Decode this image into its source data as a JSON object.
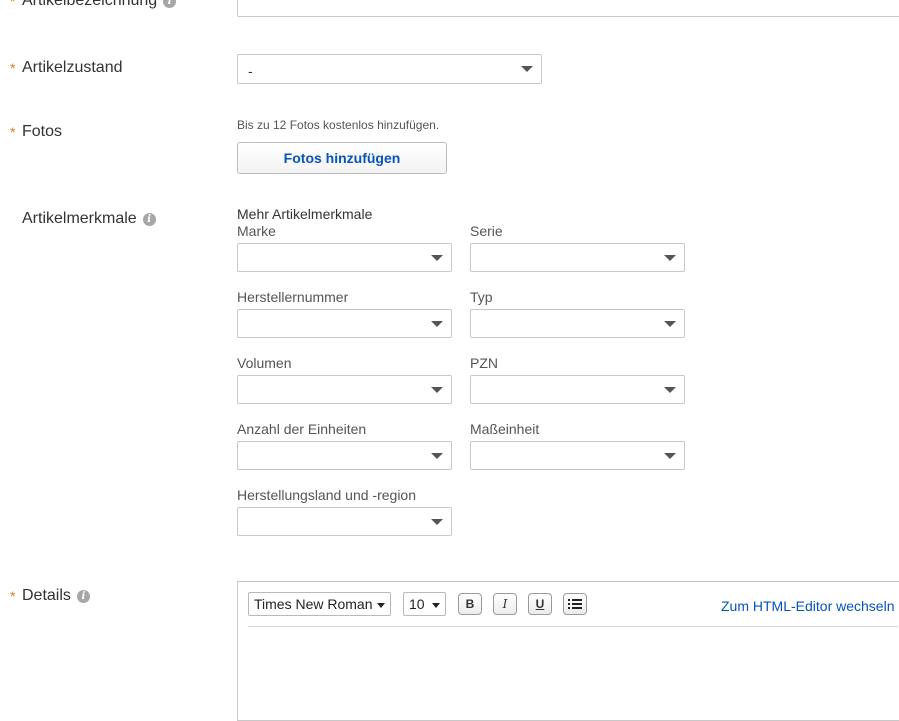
{
  "rows": {
    "title": {
      "label": "Artikelbezeichnung"
    },
    "condition": {
      "label": "Artikelzustand",
      "value": "-"
    },
    "photos": {
      "label": "Fotos",
      "hint": "Bis zu 12 Fotos kostenlos hinzufügen.",
      "button": "Fotos hinzufügen"
    },
    "specifics": {
      "label": "Artikelmerkmale",
      "heading": "Mehr Artikelmerkmale",
      "fields": {
        "marke": "Marke",
        "serie": "Serie",
        "herstellernummer": "Herstellernummer",
        "typ": "Typ",
        "volumen": "Volumen",
        "pzn": "PZN",
        "anzahl": "Anzahl der Einheiten",
        "masseinheit": "Maßeinheit",
        "herstellungsland": "Herstellungsland und -region"
      }
    },
    "details": {
      "label": "Details",
      "font_family": "Times New Roman",
      "font_size": "10",
      "bold": "B",
      "italic": "I",
      "underline": "U",
      "html_editor_link": "Zum HTML-Editor wechseln"
    }
  },
  "icons": {
    "info": "info-icon",
    "dropdown": "chevron-down-icon",
    "list": "list-icon"
  },
  "colors": {
    "required": "#e5760c",
    "link": "#0654ba"
  }
}
